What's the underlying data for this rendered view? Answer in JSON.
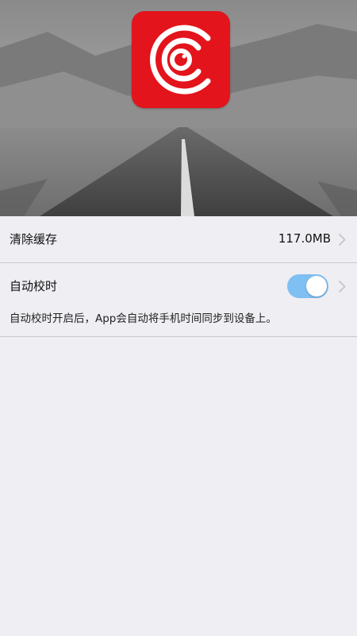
{
  "hero": {
    "background": "road-landscape-image",
    "logo_icon": "camera-c-logo-icon",
    "brand_color": "#e3141b"
  },
  "settings": {
    "clear_cache": {
      "label": "清除缓存",
      "value": "117.0MB",
      "icon": "chevron-right-icon"
    },
    "auto_time_sync": {
      "label": "自动校时",
      "enabled": true,
      "toggle_color": "#7fbff2",
      "description": "自动校时开启后，App会自动将手机时间同步到设备上。",
      "icon": "chevron-right-icon"
    }
  }
}
